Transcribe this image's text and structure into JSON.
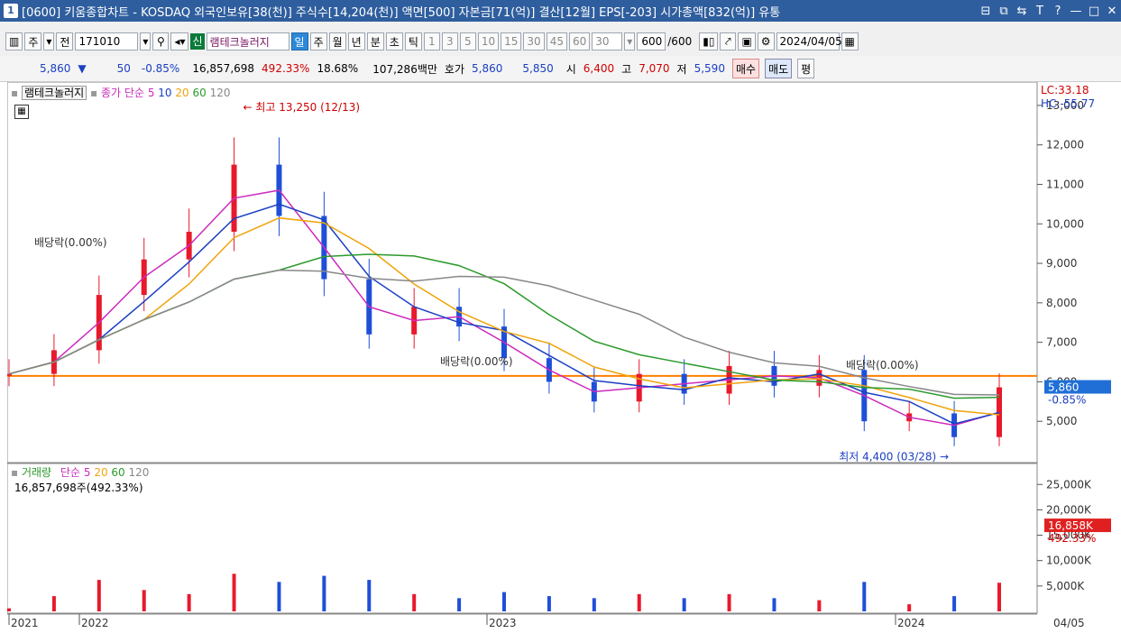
{
  "window": {
    "number": "1",
    "title": "[0600] 키움종합차트 - KOSDAQ 외국인보유[38(천)] 주식수[14,204(천)] 액면[500] 자본금[71(억)] 결산[12월] EPS[-203] 시가총액[832(억)] 유통",
    "buttons": [
      "⊟",
      "⧉",
      "⇆",
      "T",
      "?",
      "—",
      "□",
      "✕"
    ]
  },
  "toolbar": {
    "period_main": "주",
    "prev_label": "전",
    "code": "171010",
    "new_tag": "신",
    "stock_name": "램테크놀러지",
    "periods": [
      "일",
      "주",
      "월",
      "년",
      "분",
      "초",
      "틱"
    ],
    "selected_period": "일",
    "intervals": [
      "1",
      "3",
      "5",
      "10",
      "15",
      "30",
      "45",
      "60"
    ],
    "interval_value": "30",
    "count": "600",
    "count_total": "/600",
    "date": "2024/04/05"
  },
  "quote": {
    "price": "5,860",
    "direction": "▼",
    "change": "50",
    "change_pct": "-0.85%",
    "volume": "16,857,698",
    "volume_pct": "492.33%",
    "turnover_pct": "18.68%",
    "amount": "107,286백만",
    "bid_label": "호가",
    "ask": "5,860",
    "bid": "5,850",
    "open_label": "시",
    "open": "6,400",
    "high_label": "고",
    "high": "7,070",
    "low_label": "저",
    "low": "5,590",
    "buy": "매수",
    "sell": "매도",
    "eval": "평"
  },
  "price_panel": {
    "legend_name": "램테크놀러지",
    "legend_ma": "종가 단순",
    "ma_periods": [
      "5",
      "10",
      "20",
      "60",
      "120"
    ],
    "lc": "LC:33.18",
    "hc": "HC:-55.77",
    "high_marker": "최고 13,250 (12/13)",
    "low_marker": "최저 4,400 (03/28)",
    "dividend_label": "배당락(0.00%)",
    "current_price_badge": "5,860",
    "current_pct_badge": "-0.85%"
  },
  "volume_panel": {
    "legend_name": "거래량",
    "legend_ma": "단순",
    "ma_periods": [
      "5",
      "20",
      "60",
      "120"
    ],
    "volume_info": "16,857,698주(492.33%)",
    "current_badge": "16,858K",
    "current_pct": "492.33%"
  },
  "x_axis": {
    "labels": [
      "2021",
      "2022",
      "2023",
      "2024"
    ],
    "right_date": "04/05"
  },
  "colors": {
    "candle_up": "#e8192c",
    "candle_down": "#1f4fd8",
    "ma5": "#cc2bbd",
    "ma10": "#1a3fc2",
    "ma20": "#f0a30a",
    "ma60": "#2c9a2c",
    "ma120": "#888888",
    "hline": "#ff7f00"
  },
  "chart_data": {
    "type": "line",
    "title": "",
    "x": [
      "2021-01",
      "2021-03",
      "2021-06",
      "2021-08",
      "2021-10",
      "2021-11",
      "2021-12",
      "2022-01",
      "2022-03",
      "2022-05",
      "2022-07",
      "2022-09",
      "2022-11",
      "2023-01",
      "2023-03",
      "2023-05",
      "2023-07",
      "2023-09",
      "2023-11",
      "2024-01",
      "2024-02",
      "2024-03",
      "2024-04"
    ],
    "series": [
      {
        "name": "종가",
        "values": [
          6200,
          6800,
          8200,
          9100,
          9800,
          11500,
          10200,
          8600,
          7200,
          7900,
          7400,
          6600,
          6000,
          5500,
          6200,
          5700,
          6400,
          5900,
          6300,
          5000,
          5200,
          4600,
          5860
        ]
      }
    ],
    "horizontal_line": 6150,
    "ylim": [
      4000,
      13500
    ],
    "y_ticks": [
      5000,
      6000,
      7000,
      8000,
      9000,
      10000,
      11000,
      12000,
      13000
    ],
    "volume_ylim": [
      0,
      27000
    ],
    "volume_ticks_k": [
      5000,
      10000,
      15000,
      20000,
      25000
    ]
  }
}
